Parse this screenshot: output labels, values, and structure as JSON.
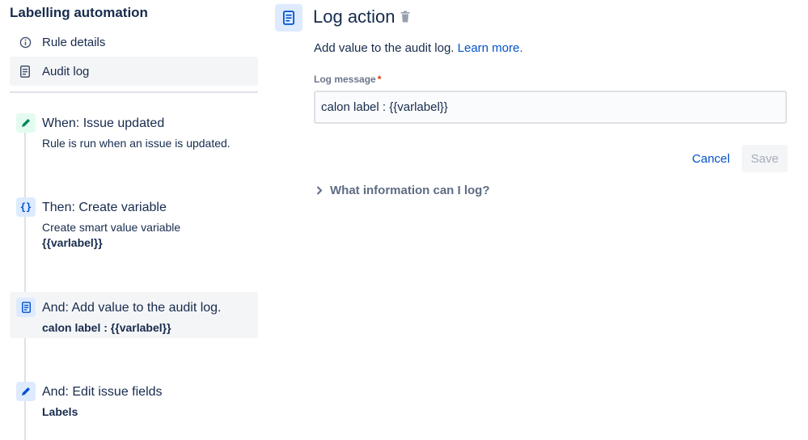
{
  "sidebar": {
    "title": "Labelling automation",
    "nav": [
      {
        "label": "Rule details",
        "icon": "info-icon"
      },
      {
        "label": "Audit log",
        "icon": "document-icon"
      }
    ],
    "steps": [
      {
        "title": "When: Issue updated",
        "sub": "Rule is run when an issue is updated.",
        "bold": "",
        "icon": "pencil-icon",
        "badge_color": "#e3fcef",
        "icon_color": "#00875a"
      },
      {
        "title": "Then: Create variable",
        "sub": "Create smart value variable",
        "bold": "{{varlabel}}",
        "icon": "braces-icon",
        "badge_color": "#deebff",
        "icon_color": "#0052cc"
      },
      {
        "title": "And: Add value to the audit log.",
        "sub": "",
        "bold": "calon label : {{varlabel}}",
        "icon": "document-icon",
        "badge_color": "#deebff",
        "icon_color": "#0052cc"
      },
      {
        "title": "And: Edit issue fields",
        "sub": "",
        "bold": "Labels",
        "icon": "pencil-icon",
        "badge_color": "#deebff",
        "icon_color": "#0052cc"
      }
    ]
  },
  "panel": {
    "title": "Log action",
    "description": "Add value to the audit log.",
    "learn_more": "Learn more.",
    "field_label": "Log message",
    "required_mark": "*",
    "message_value": "calon label : {{varlabel}}",
    "cancel_label": "Cancel",
    "save_label": "Save",
    "expander_label": "What information can I log?"
  },
  "colors": {
    "accent": "#0052cc",
    "selected_bg": "#f4f5f7",
    "green": "#00875a"
  }
}
